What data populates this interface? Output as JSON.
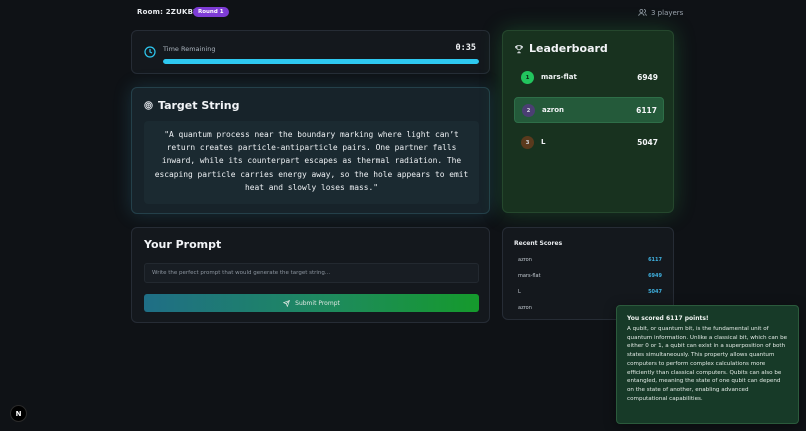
{
  "header": {
    "room_label": "Room: 2ZUKBX",
    "round_badge": "Round 1",
    "players": "3 players"
  },
  "timer": {
    "label": "Time Remaining",
    "value": "0:35",
    "progress_fraction": 1.0
  },
  "target": {
    "title": "Target String",
    "text": "\"A quantum process near the boundary marking where light can’t return creates particle-antiparticle pairs. One partner falls inward, while its counterpart escapes as thermal radiation. The escaping particle carries energy away, so the hole appears to emit heat and slowly loses mass.\""
  },
  "prompt": {
    "title": "Your Prompt",
    "placeholder": "Write the perfect prompt that would generate the target string...",
    "value": "",
    "submit_label": "Submit Prompt"
  },
  "leaderboard": {
    "title": "Leaderboard",
    "entries": [
      {
        "rank": "1",
        "name": "mars-flat",
        "score": "6949",
        "rank_color": "#22c55e"
      },
      {
        "rank": "2",
        "name": "azron",
        "score": "6117",
        "rank_color": "#4b3f73"
      },
      {
        "rank": "3",
        "name": "L",
        "score": "5047",
        "rank_color": "#5a3a1d"
      }
    ]
  },
  "recent_scores": {
    "title": "Recent Scores",
    "entries": [
      {
        "name": "azron",
        "score": "6117"
      },
      {
        "name": "mars-flat",
        "score": "6949"
      },
      {
        "name": "L",
        "score": "5047"
      },
      {
        "name": "azron",
        "score": ""
      }
    ]
  },
  "toast": {
    "title": "You scored 6117 points!",
    "body": "A qubit, or quantum bit, is the fundamental unit of quantum information. Unlike a classical bit, which can be either 0 or 1, a qubit can exist in a superposition of both states simultaneously. This property allows quantum computers to perform complex calculations more efficiently than classical computers. Qubits can also be entangled, meaning the state of one qubit can depend on the state of another, enabling advanced computational capabilities."
  },
  "dev_badge": "N",
  "colors": {
    "accent_cyan": "#2ec8f0",
    "round_purple": "#7e3cd6",
    "leaderboard_green": "#18321f",
    "score_blue": "#3fb1e0"
  }
}
